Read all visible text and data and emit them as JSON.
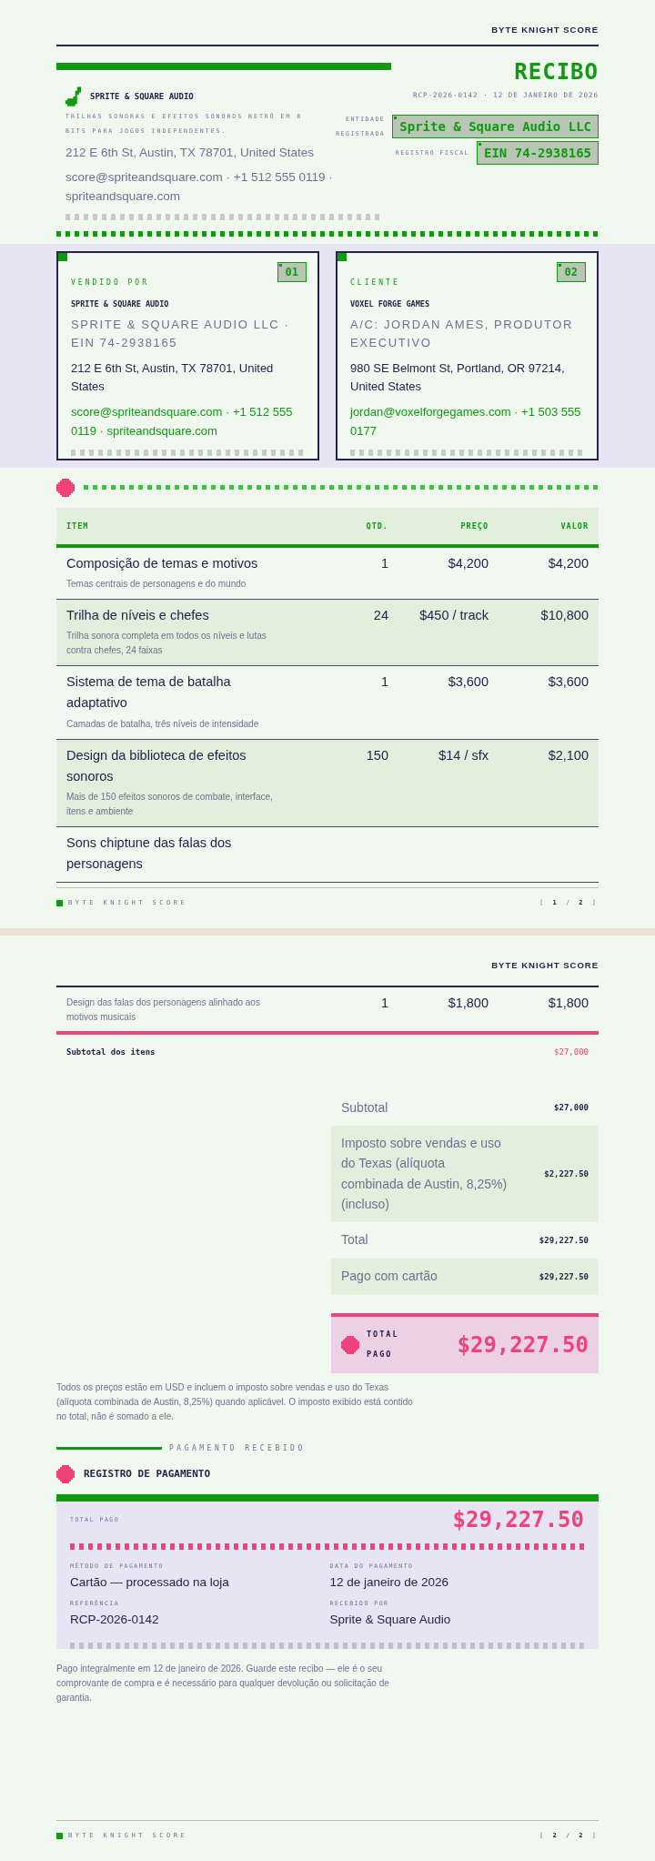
{
  "page1": {
    "brand": "BYTE KNIGHT SCORE",
    "doc_title": "RECIBO",
    "doc_meta": "RCP-2026-0142 · 12 DE JANEIRO DE 2026",
    "company": {
      "name": "SPRITE & SQUARE AUDIO",
      "tagline": "TRILHAS SONORAS E EFEITOS SONOROS RETRÔ EM 8 BITS PARA JOGOS INDEPENDENTES.",
      "address": "212 E 6th St, Austin, TX 78701, United States",
      "contact": "score@spriteandsquare.com · +1 512 555 0119 · spriteandsquare.com"
    },
    "registry": [
      {
        "label": "ENTIDADE REGISTRADA",
        "value": "Sprite & Square Audio LLC"
      },
      {
        "label": "REGISTRO FISCAL",
        "value": "EIN 74-2938165"
      }
    ],
    "parties": [
      {
        "label": "VENDIDO POR",
        "number": "01",
        "name": "SPRITE & SQUARE AUDIO",
        "subtitle": "SPRITE & SQUARE AUDIO LLC · EIN 74-2938165",
        "address": "212 E 6th St, Austin, TX 78701, United States",
        "contact": "score@spriteandsquare.com · +1 512 555 0119 · spriteandsquare.com"
      },
      {
        "label": "CLIENTE",
        "number": "02",
        "name": "VOXEL FORGE GAMES",
        "subtitle": "A/C: JORDAN AMES, PRODUTOR EXECUTIVO",
        "address": "980 SE Belmont St, Portland, OR 97214, United States",
        "contact": "jordan@voxelforgegames.com · +1 503 555 0177"
      }
    ],
    "table": {
      "columns": [
        "ITEM",
        "QTD.",
        "PREÇO",
        "VALOR"
      ],
      "rows": [
        {
          "title": "Composição de temas e motivos",
          "description": "Temas centrais de personagens e do mundo",
          "qty": "1",
          "price": "$4,200",
          "amount": "$4,200"
        },
        {
          "title": "Trilha de níveis e chefes",
          "description": "Trilha sonora completa em todos os níveis e lutas contra chefes, 24 faixas",
          "qty": "24",
          "price": "$450 / track",
          "amount": "$10,800"
        },
        {
          "title": "Sistema de tema de batalha adaptativo",
          "description": "Camadas de batalha, três níveis de intensidade",
          "qty": "1",
          "price": "$3,600",
          "amount": "$3,600"
        },
        {
          "title": "Design da biblioteca de efeitos sonoros",
          "description": "Mais de 150 efeitos sonoros de combate, interface, itens e ambiente",
          "qty": "150",
          "price": "$14 / sfx",
          "amount": "$2,100"
        },
        {
          "title": "Sons chiptune das falas dos personagens"
        }
      ]
    },
    "footer": {
      "brand": "BYTE KNIGHT SCORE",
      "page": "[ **1** / **2** ]"
    }
  },
  "page2": {
    "brand": "BYTE KNIGHT SCORE",
    "table": {
      "rows": [
        {
          "description": "Design das falas dos personagens alinhado aos motivos musicais",
          "qty": "1",
          "price": "$1,800",
          "amount": "$1,800"
        }
      ]
    },
    "items_subtotal": {
      "label": "Subtotal dos itens",
      "value": "$27,000"
    },
    "summary": [
      {
        "label": "Subtotal",
        "value": "$27,000"
      },
      {
        "label": "Imposto sobre vendas e uso do Texas (alíquota combinada de Austin, 8,25%) (incluso)",
        "value": "$2,227.50"
      },
      {
        "label": "Total",
        "value": "$29,227.50"
      },
      {
        "label": "Pago com cartão",
        "value": "$29,227.50"
      }
    ],
    "grand_total": {
      "label": "TOTAL PAGO",
      "value": "$29,227.50"
    },
    "tax_note": "Todos os preços estão em USD e incluem o imposto sobre vendas e uso do Texas (alíquota combinada de Austin, 8,25%) quando aplicável. O imposto exibido está contido no total, não é somado a ele.",
    "payment": {
      "section_label": "PAGAMENTO RECEBIDO",
      "title": "REGISTRO DE PAGAMENTO",
      "total_label": "TOTAL PAGO",
      "total_value": "$29,227.50",
      "fields": [
        {
          "label": "MÉTODO DE PAGAMENTO",
          "value": "Cartão — processado na loja"
        },
        {
          "label": "DATA DO PAGAMENTO",
          "value": "12 de janeiro de 2026"
        },
        {
          "label": "REFERÊNCIA",
          "value": "RCP-2026-0142"
        },
        {
          "label": "RECEBIDO POR",
          "value": "Sprite & Square Audio"
        }
      ]
    },
    "closing_note": "Pago integralmente em 12 de janeiro de 2026. Guarde este recibo — ele é o seu comprovante de compra e é necessário para qualquer devolução ou solicitação de garantia.",
    "footer": {
      "brand": "BYTE KNIGHT SCORE",
      "page": "[ **2** / **2** ]"
    }
  }
}
